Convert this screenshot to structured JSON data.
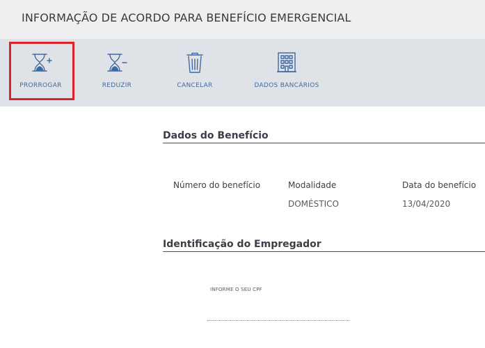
{
  "header": {
    "title": "INFORMAÇÃO DE ACORDO PARA BENEFÍCIO EMERGENCIAL"
  },
  "toolbar": {
    "actions": [
      {
        "label": "PRORROGAR",
        "icon": "hourglass-plus-icon"
      },
      {
        "label": "REDUZIR",
        "icon": "hourglass-minus-icon"
      },
      {
        "label": "CANCELAR",
        "icon": "trash-icon"
      },
      {
        "label": "DADOS BANCÁRIOS",
        "icon": "building-icon"
      }
    ],
    "highlighted_action": "PRORROGAR",
    "highlight_color": "#d8232a",
    "accent_color": "#3f6aa1"
  },
  "dados_beneficio": {
    "title": "Dados do Benefício",
    "fields": [
      {
        "label": "Número do benefício",
        "value": ""
      },
      {
        "label": "Modalidade",
        "value": "DOMÉSTICO"
      },
      {
        "label": "Data do benefício",
        "value": "13/04/2020"
      }
    ]
  },
  "identificacao_empregador": {
    "title": "Identificação do Empregador",
    "cpf_label": "INFORME O SEU CPF",
    "cpf_value": ""
  }
}
